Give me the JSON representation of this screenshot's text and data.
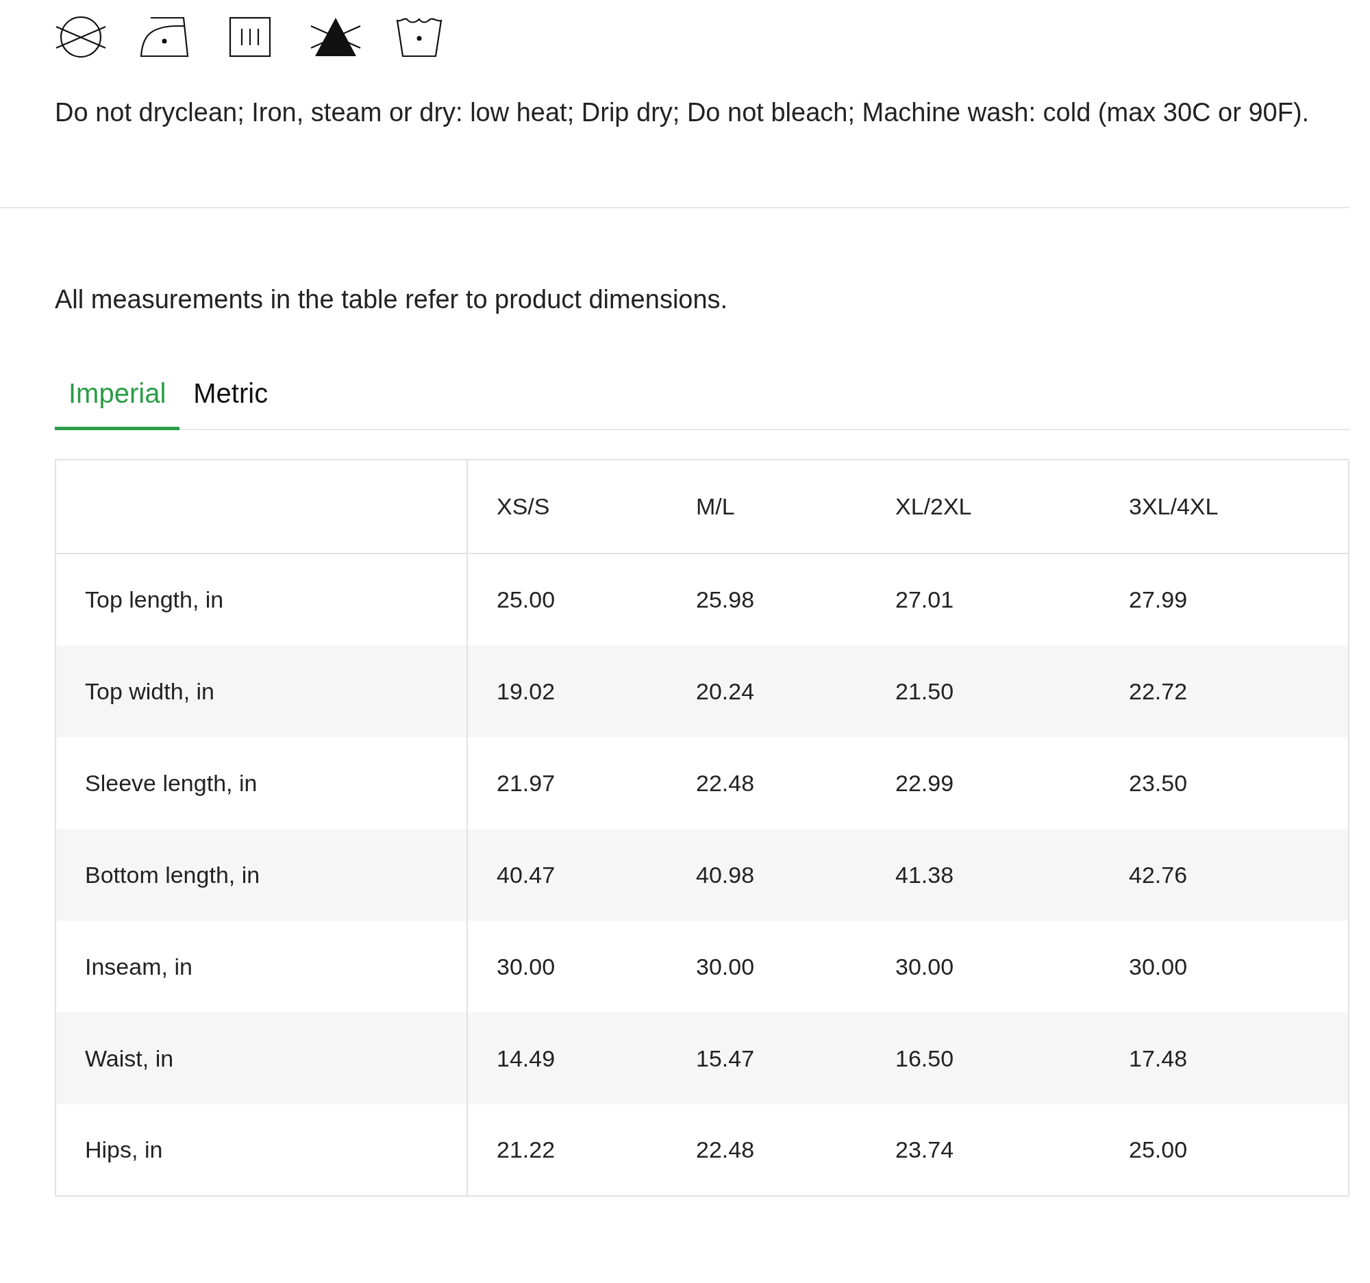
{
  "care": {
    "icons": [
      {
        "kind": "no-dryclean"
      },
      {
        "kind": "iron-low"
      },
      {
        "kind": "drip-dry"
      },
      {
        "kind": "no-bleach"
      },
      {
        "kind": "wash-cold"
      }
    ],
    "text": "Do not dryclean; Iron, steam or dry: low heat; Drip dry; Do not bleach; Machine wash: cold (max 30C or 90F)."
  },
  "note": "All measurements in the table refer to product dimensions.",
  "tabs": [
    {
      "label": "Imperial",
      "selected": true
    },
    {
      "label": "Metric",
      "selected": false
    }
  ],
  "table": {
    "columns": [
      "XS/S",
      "M/L",
      "XL/2XL",
      "3XL/4XL"
    ],
    "rows": [
      {
        "label": "Top length, in",
        "values": [
          "25.00",
          "25.98",
          "27.01",
          "27.99"
        ]
      },
      {
        "label": "Top width, in",
        "values": [
          "19.02",
          "20.24",
          "21.50",
          "22.72"
        ]
      },
      {
        "label": "Sleeve length, in",
        "values": [
          "21.97",
          "22.48",
          "22.99",
          "23.50"
        ]
      },
      {
        "label": "Bottom length, in",
        "values": [
          "40.47",
          "40.98",
          "41.38",
          "42.76"
        ]
      },
      {
        "label": "Inseam, in",
        "values": [
          "30.00",
          "30.00",
          "30.00",
          "30.00"
        ]
      },
      {
        "label": "Waist, in",
        "values": [
          "14.49",
          "15.47",
          "16.50",
          "17.48"
        ]
      },
      {
        "label": "Hips, in",
        "values": [
          "21.22",
          "22.48",
          "23.74",
          "25.00"
        ]
      }
    ]
  }
}
